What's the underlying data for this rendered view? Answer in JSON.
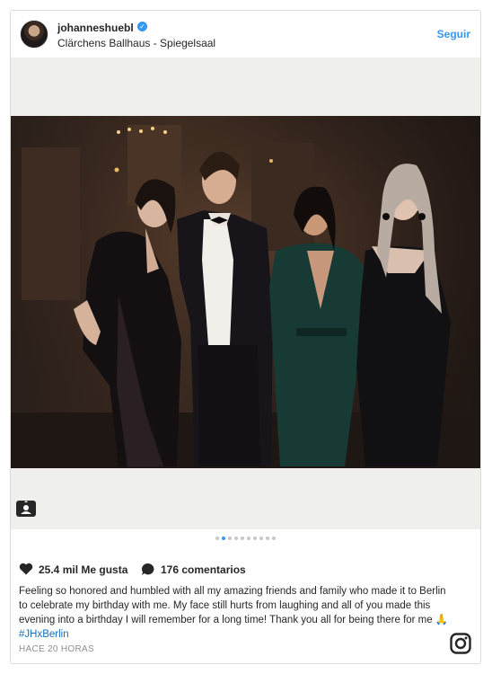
{
  "post": {
    "username": "johanneshuebl",
    "location": "Clärchens Ballhaus - Spiegelsaal",
    "follow_label": "Seguir",
    "likes": "25.4 mil Me gusta",
    "comments": "176 comentarios",
    "caption_text": "Feeling so honored and humbled with all my amazing friends and family who made it to Berlin to celebrate my birthday with me. My face still hurts from laughing and all of you made this evening into a birthday I will remember for a long time! Thank you all for being there for me",
    "caption_emoji": "🙏",
    "hashtag": "#JHxBerlin",
    "timestamp": "HACE 20 HORAS",
    "carousel": {
      "total": 10,
      "active_index": 1
    }
  },
  "colors": {
    "accent": "#3897f0",
    "hashtag": "#1a6eb5",
    "text": "#262626",
    "muted": "#8e8e8e"
  },
  "icons": {
    "verified": "verified-badge-icon",
    "tag": "user-tag-icon",
    "like": "heart-icon",
    "comment": "comment-bubble-icon",
    "brand": "instagram-icon"
  }
}
